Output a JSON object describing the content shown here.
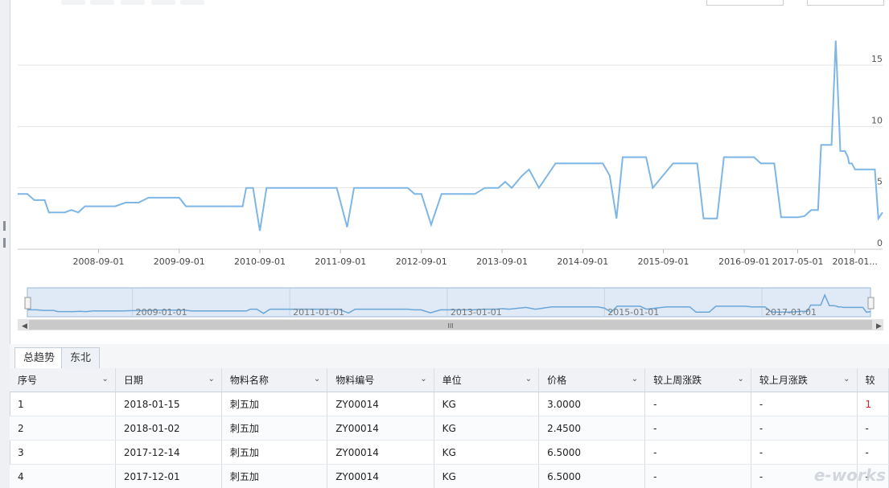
{
  "top_buttons_count": 5,
  "chart_data": {
    "type": "line",
    "title": "",
    "xlabel": "",
    "ylabel": "",
    "ylim": [
      0,
      19
    ],
    "yticks": [
      0,
      5,
      10,
      15
    ],
    "y_axis_side": "right",
    "grid": "horizontal",
    "x_tick_labels": [
      "2008-09-01",
      "2009-09-01",
      "2010-09-01",
      "2011-09-01",
      "2012-09-01",
      "2013-09-01",
      "2014-09-01",
      "2015-09-01",
      "2016-09-01",
      "2017-05-01",
      "2018-01..."
    ],
    "line_color": "#7eb6e6",
    "series": [
      {
        "values": [
          [
            "2007-09-01",
            4.5
          ],
          [
            "2007-10-15",
            4.5
          ],
          [
            "2007-11-15",
            4.0
          ],
          [
            "2008-01-01",
            4.0
          ],
          [
            "2008-01-20",
            3.0
          ],
          [
            "2008-04-01",
            3.0
          ],
          [
            "2008-05-01",
            3.2
          ],
          [
            "2008-06-01",
            3.0
          ],
          [
            "2008-07-01",
            3.5
          ],
          [
            "2008-11-15",
            3.5
          ],
          [
            "2009-01-01",
            3.8
          ],
          [
            "2009-03-01",
            3.8
          ],
          [
            "2009-04-15",
            4.2
          ],
          [
            "2009-08-01",
            4.2
          ],
          [
            "2009-09-01",
            4.2
          ],
          [
            "2009-10-01",
            3.5
          ],
          [
            "2010-06-15",
            3.5
          ],
          [
            "2010-07-01",
            5.0
          ],
          [
            "2010-08-01",
            5.0
          ],
          [
            "2010-09-01",
            1.5
          ],
          [
            "2010-10-01",
            5.0
          ],
          [
            "2011-08-15",
            5.0
          ],
          [
            "2011-10-01",
            1.8
          ],
          [
            "2011-11-01",
            5.0
          ],
          [
            "2012-07-01",
            5.0
          ],
          [
            "2012-08-01",
            4.5
          ],
          [
            "2012-09-01",
            4.5
          ],
          [
            "2012-10-15",
            2.0
          ],
          [
            "2012-12-01",
            4.5
          ],
          [
            "2013-05-01",
            4.5
          ],
          [
            "2013-06-15",
            5.0
          ],
          [
            "2013-08-15",
            5.0
          ],
          [
            "2013-09-15",
            5.5
          ],
          [
            "2013-10-15",
            5.0
          ],
          [
            "2013-12-01",
            6.0
          ],
          [
            "2014-01-01",
            6.5
          ],
          [
            "2014-02-15",
            5.0
          ],
          [
            "2014-05-01",
            7.0
          ],
          [
            "2014-12-01",
            7.0
          ],
          [
            "2015-01-01",
            6.0
          ],
          [
            "2015-02-01",
            2.5
          ],
          [
            "2015-03-01",
            7.5
          ],
          [
            "2015-06-15",
            7.5
          ],
          [
            "2015-07-15",
            5.0
          ],
          [
            "2015-10-15",
            7.0
          ],
          [
            "2016-02-01",
            7.0
          ],
          [
            "2016-03-01",
            2.5
          ],
          [
            "2016-05-01",
            2.5
          ],
          [
            "2016-06-01",
            7.5
          ],
          [
            "2016-10-15",
            7.5
          ],
          [
            "2016-11-15",
            7.0
          ],
          [
            "2017-01-15",
            7.0
          ],
          [
            "2017-02-15",
            2.6
          ],
          [
            "2017-05-01",
            2.6
          ],
          [
            "2017-06-01",
            2.7
          ],
          [
            "2017-07-01",
            3.2
          ],
          [
            "2017-08-01",
            3.2
          ],
          [
            "2017-08-15",
            8.5
          ],
          [
            "2017-10-01",
            8.5
          ],
          [
            "2017-10-20",
            17.0
          ],
          [
            "2017-11-10",
            8.0
          ],
          [
            "2017-12-01",
            8.0
          ],
          [
            "2017-12-14",
            7.5
          ],
          [
            "2017-12-20",
            7.0
          ],
          [
            "2018-01-01",
            7.0
          ],
          [
            "2018-01-15",
            6.5
          ],
          [
            "2018-02-01",
            6.5
          ],
          [
            "2018-04-15",
            6.5
          ],
          [
            "2018-05-01",
            2.5
          ],
          [
            "2018-05-20",
            3.0
          ]
        ]
      }
    ]
  },
  "navigator": {
    "labels": [
      "2009-01-01",
      "2011-01-01",
      "2013-01-01",
      "2015-01-01",
      "2017-01-01"
    ],
    "scroll_grip": "III"
  },
  "tabs": [
    {
      "label": "总趋势",
      "active": true
    },
    {
      "label": "东北",
      "active": false
    }
  ],
  "table": {
    "columns": [
      "序号",
      "日期",
      "物料名称",
      "物料编号",
      "单位",
      "价格",
      "较上周涨跌",
      "较上月涨跌",
      "较"
    ],
    "rows": [
      [
        "1",
        "2018-01-15",
        "刺五加",
        "ZY00014",
        "KG",
        "3.0000",
        "-",
        "-",
        "1"
      ],
      [
        "2",
        "2018-01-02",
        "刺五加",
        "ZY00014",
        "KG",
        "2.4500",
        "-",
        "-",
        "-"
      ],
      [
        "3",
        "2017-12-14",
        "刺五加",
        "ZY00014",
        "KG",
        "6.5000",
        "-",
        "-",
        "-"
      ],
      [
        "4",
        "2017-12-01",
        "刺五加",
        "ZY00014",
        "KG",
        "6.5000",
        "-",
        "-",
        "-"
      ]
    ]
  },
  "watermark": "e-works"
}
